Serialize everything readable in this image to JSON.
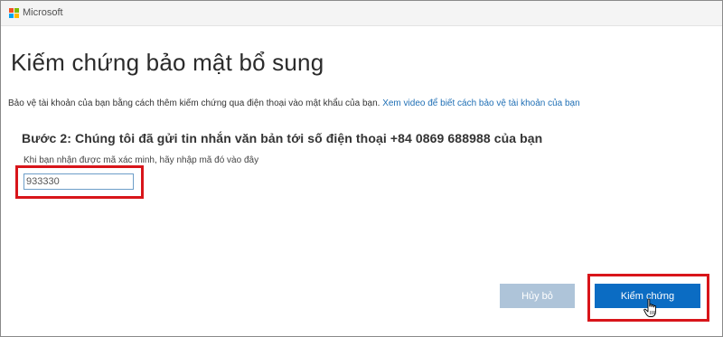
{
  "header": {
    "brand": "Microsoft"
  },
  "page": {
    "title": "Kiếm chứng bảo mật bổ sung",
    "intro": "Bảo vệ tài khoản của bạn bằng cách thêm kiếm chứng qua điện thoại vào mật khẩu của bạn.",
    "intro_link": "Xem video để biết cách bảo vệ tài khoản của bạn",
    "step": "Bước 2: Chúng tôi đã gửi tin nhắn văn bản tới số điện thoại +84 0869 688988  của bạn",
    "hint": "Khi bạn nhận được mã xác minh, hãy nhập mã đó vào đây",
    "code_value": "933330"
  },
  "buttons": {
    "cancel": "Hủy bỏ",
    "verify": "Kiểm chứng"
  },
  "colors": {
    "primary": "#0b6cc3",
    "disabled": "#aec4d9",
    "highlight": "#d8151a",
    "link": "#1f6fb5"
  },
  "icons": {
    "logo": "microsoft-logo-icon",
    "cursor": "hand-pointer-icon"
  }
}
